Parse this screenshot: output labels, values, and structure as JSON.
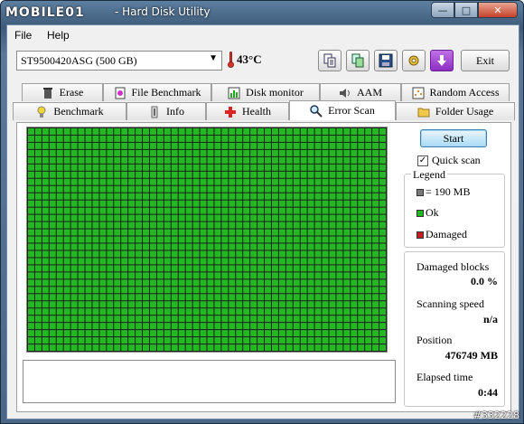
{
  "window": {
    "logo_text": "MOBILE01",
    "title": "- Hard Disk Utility",
    "controls": {
      "minimize": "—",
      "maximize": "□",
      "close": "✕"
    }
  },
  "menu": {
    "file": "File",
    "help": "Help"
  },
  "drive": {
    "selected": "ST9500420ASG (500 GB)",
    "temperature": "43°C"
  },
  "toolbar": {
    "exit_label": "Exit"
  },
  "tabs_row1": [
    {
      "label": "Erase",
      "icon": "trash-icon"
    },
    {
      "label": "File Benchmark",
      "icon": "file-benchmark-icon"
    },
    {
      "label": "Disk monitor",
      "icon": "monitor-chart-icon"
    },
    {
      "label": "AAM",
      "icon": "speaker-icon"
    },
    {
      "label": "Random Access",
      "icon": "random-access-icon"
    }
  ],
  "tabs_row2": [
    {
      "label": "Benchmark",
      "icon": "lightbulb-icon"
    },
    {
      "label": "Info",
      "icon": "info-icon"
    },
    {
      "label": "Health",
      "icon": "health-cross-icon"
    },
    {
      "label": "Error Scan",
      "icon": "magnifier-icon",
      "active": true
    },
    {
      "label": "Folder Usage",
      "icon": "folder-icon"
    }
  ],
  "scan": {
    "start_label": "Start",
    "quick_scan_label": "Quick scan",
    "quick_scan_checked": true,
    "grid_color": "#22b922",
    "grid_columns": 50,
    "grid_rows": 31
  },
  "legend": {
    "title": "Legend",
    "block_size": "= 190 MB",
    "ok": "Ok",
    "damaged": "Damaged",
    "colors": {
      "block": "#7a7a7a",
      "ok": "#22b922",
      "damaged": "#c02020"
    }
  },
  "stats": {
    "damaged_blocks_label": "Damaged blocks",
    "damaged_blocks_value": "0.0 %",
    "scanning_speed_label": "Scanning speed",
    "scanning_speed_value": "n/a",
    "position_label": "Position",
    "position_value": "476749 MB",
    "elapsed_label": "Elapsed time",
    "elapsed_value": "0:44"
  },
  "watermark": "#332228"
}
